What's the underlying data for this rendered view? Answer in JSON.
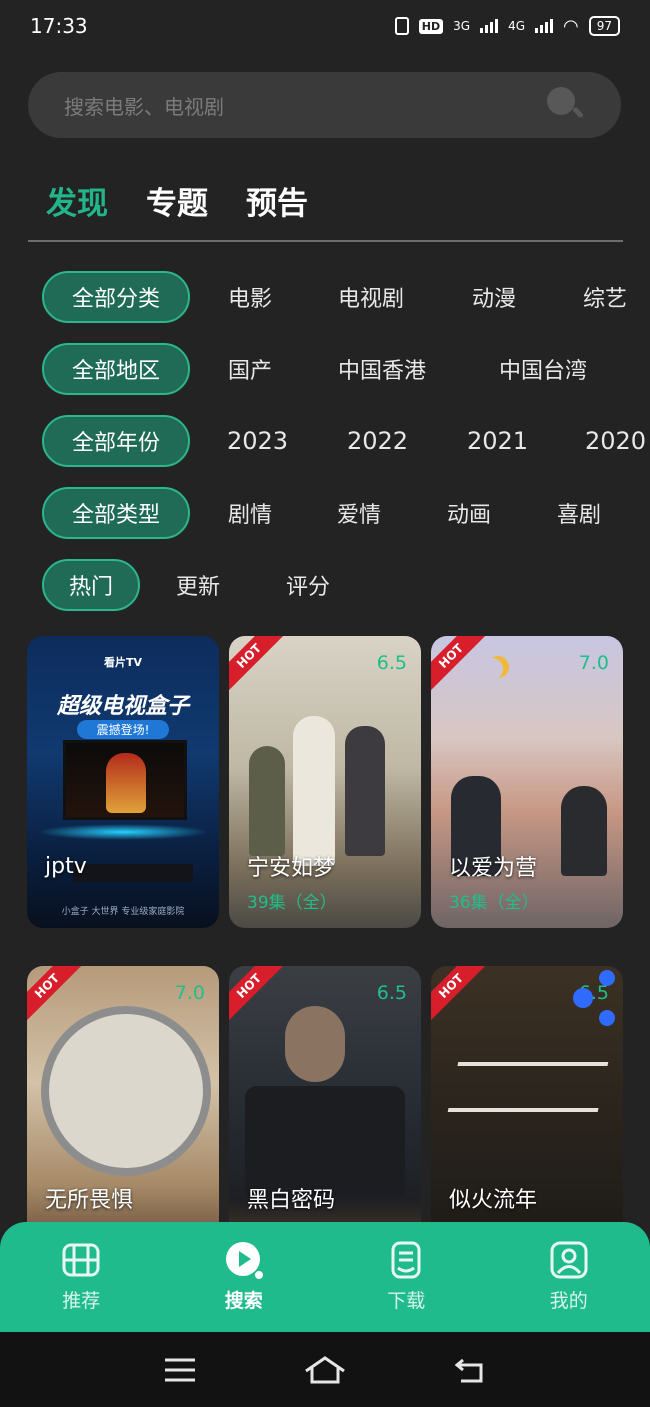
{
  "status": {
    "time": "17:33",
    "network1": "3G",
    "network2": "4G",
    "hd": "HD",
    "battery": "97"
  },
  "search": {
    "placeholder": "搜索电影、电视剧"
  },
  "tabs": [
    "发现",
    "专题",
    "预告"
  ],
  "filters": {
    "category": {
      "selected": "全部分类",
      "options": [
        "电影",
        "电视剧",
        "动漫",
        "综艺"
      ]
    },
    "region": {
      "selected": "全部地区",
      "options": [
        "国产",
        "中国香港",
        "中国台湾"
      ]
    },
    "year": {
      "selected": "全部年份",
      "options": [
        "2023",
        "2022",
        "2021",
        "2020"
      ]
    },
    "type": {
      "selected": "全部类型",
      "options": [
        "剧情",
        "爱情",
        "动画",
        "喜剧"
      ]
    },
    "sort": {
      "selected": "热门",
      "options": [
        "更新",
        "评分"
      ]
    }
  },
  "cards": [
    {
      "title": "jptv",
      "sub": "",
      "score": "",
      "hot": "",
      "banner_brand": "看片TV",
      "banner_title": "超级电视盒子",
      "banner_sub": "震撼登场!",
      "banner_foot": "小盒子 大世界 专业级家庭影院"
    },
    {
      "title": "宁安如梦",
      "sub": "39集（全）",
      "score": "6.5",
      "hot": "HOT"
    },
    {
      "title": "以爱为营",
      "sub": "36集（全）",
      "score": "7.0",
      "hot": "HOT"
    },
    {
      "title": "无所畏惧",
      "sub": "",
      "score": "7.0",
      "hot": "HOT"
    },
    {
      "title": "黑白密码",
      "sub": "",
      "score": "6.5",
      "hot": "HOT"
    },
    {
      "title": "似火流年",
      "sub": "",
      "score": "6.5",
      "hot": "HOT"
    }
  ],
  "nav": [
    {
      "label": "推荐",
      "icon": "film-icon"
    },
    {
      "label": "搜索",
      "icon": "play-circle-icon"
    },
    {
      "label": "下载",
      "icon": "download-icon"
    },
    {
      "label": "我的",
      "icon": "profile-icon"
    }
  ],
  "colors": {
    "accent": "#22b589",
    "background": "#232323",
    "pill": "#1f6b55",
    "nav": "#1fbb8c",
    "hot": "#d81d2b"
  }
}
